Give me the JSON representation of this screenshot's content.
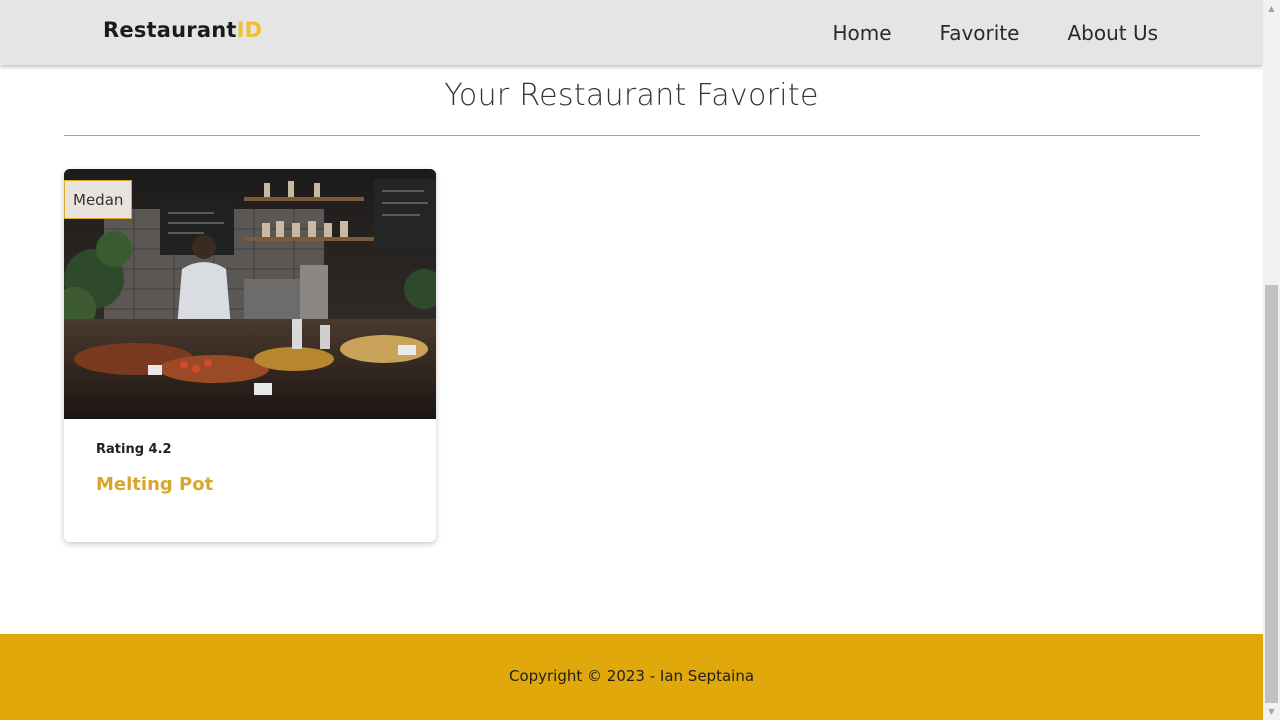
{
  "header": {
    "brand_main": "Restaurant",
    "brand_accent": "ID",
    "nav": [
      {
        "label": "Home"
      },
      {
        "label": "Favorite"
      },
      {
        "label": "About Us"
      }
    ]
  },
  "main": {
    "title": "Your Restaurant Favorite",
    "restaurants": [
      {
        "city": "Medan",
        "rating_label": "Rating 4.2",
        "name": "Melting Pot"
      }
    ]
  },
  "footer": {
    "copyright": "Copyright © 2023 - Ian Septaina"
  },
  "colors": {
    "accent": "#e0a80b",
    "brand_accent": "#f0c030",
    "name": "#d9a52b",
    "header_bg": "#e5e5e5"
  },
  "icons": {
    "scroll_up": "▲",
    "scroll_down": "▼"
  }
}
